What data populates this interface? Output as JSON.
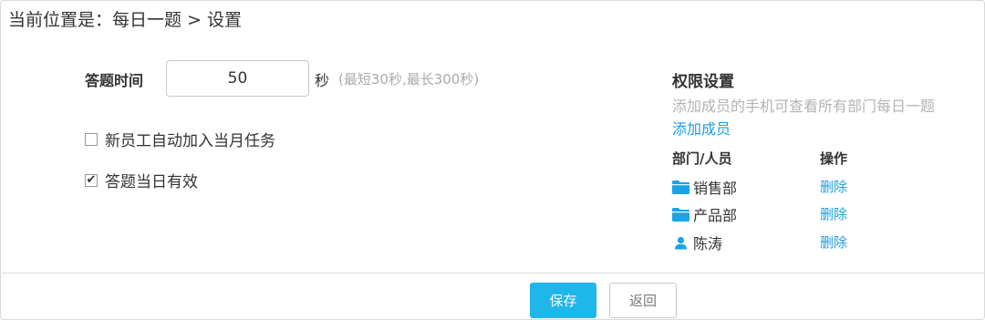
{
  "breadcrumb": "当前位置是：每日一题 > 设置",
  "settings": {
    "time_label": "答题时间",
    "time_value": "50",
    "time_unit": "秒",
    "time_hint": "(最短30秒,最长300秒)",
    "checkboxes": [
      {
        "label": "新员工自动加入当月任务",
        "checked": false
      },
      {
        "label": "答题当日有效",
        "checked": true
      }
    ]
  },
  "permissions": {
    "title": "权限设置",
    "description": "添加成员的手机可查看所有部门每日一题",
    "add_member": "添加成员",
    "columns": [
      "部门/人员",
      "操作"
    ],
    "rows": [
      {
        "name": "销售部",
        "type": "folder-icon",
        "action": "删除"
      },
      {
        "name": "产品部",
        "type": "folder-icon",
        "action": "删除"
      },
      {
        "name": "陈涛",
        "type": "user-icon",
        "action": "删除"
      }
    ]
  },
  "footer": {
    "save_label": "保存",
    "back_label": "返回"
  },
  "colors": {
    "accent": "#1fb6ea",
    "link": "#1e9fe0",
    "icon": "#1ba3e8",
    "hint": "#aaaaaa"
  }
}
